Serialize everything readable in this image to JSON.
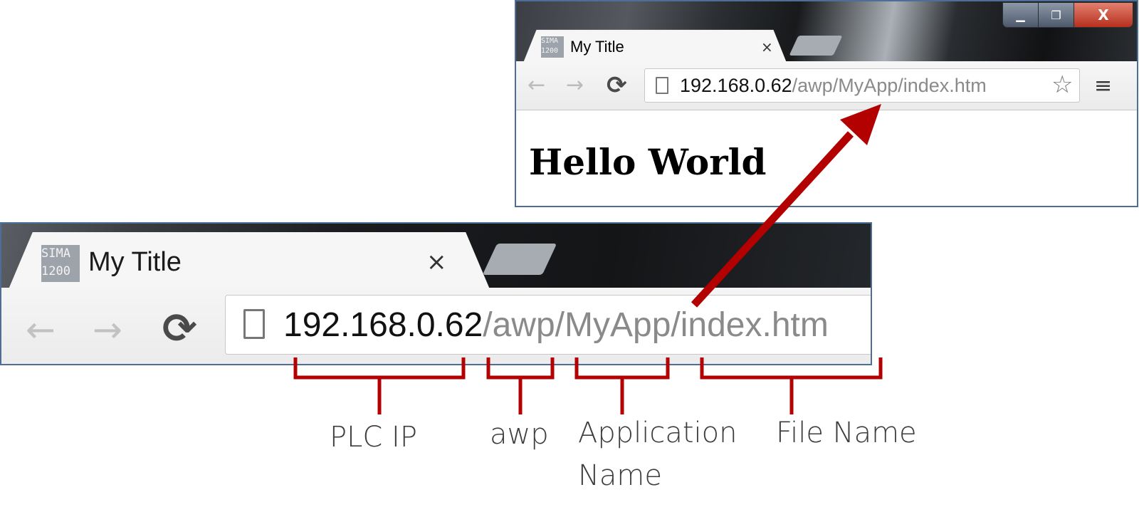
{
  "small_browser": {
    "window_buttons": {
      "minimize": "▁",
      "maximize": "❐",
      "close": "X"
    },
    "tab": {
      "icon_text": "SIMA\n1200",
      "title": "My Title",
      "close": "×"
    },
    "toolbar": {
      "back": "←",
      "forward": "→",
      "reload": "⟳"
    },
    "address": {
      "host": "192.168.0.62",
      "path": "/awp/MyApp/index.htm"
    },
    "star": "☆",
    "menu": "≡",
    "page_heading": "Hello World"
  },
  "large_browser": {
    "tab": {
      "icon_text": "SIMA\n1200",
      "title": "My Title",
      "close": "×"
    },
    "toolbar": {
      "back": "←",
      "forward": "→",
      "reload": "⟳"
    },
    "address": {
      "host": "192.168.0.62",
      "seg_awp": "/awp",
      "seg_app": "/MyApp",
      "seg_file": "/index.htm"
    }
  },
  "annotations": {
    "plc_ip": "PLC IP",
    "awp": "awp",
    "app_name_line1": "Application",
    "app_name_line2": "Name",
    "file_name": "File Name"
  },
  "colors": {
    "accent_red": "#b30000",
    "window_border": "#4f6e96",
    "url_path": "#8a8a8a"
  }
}
